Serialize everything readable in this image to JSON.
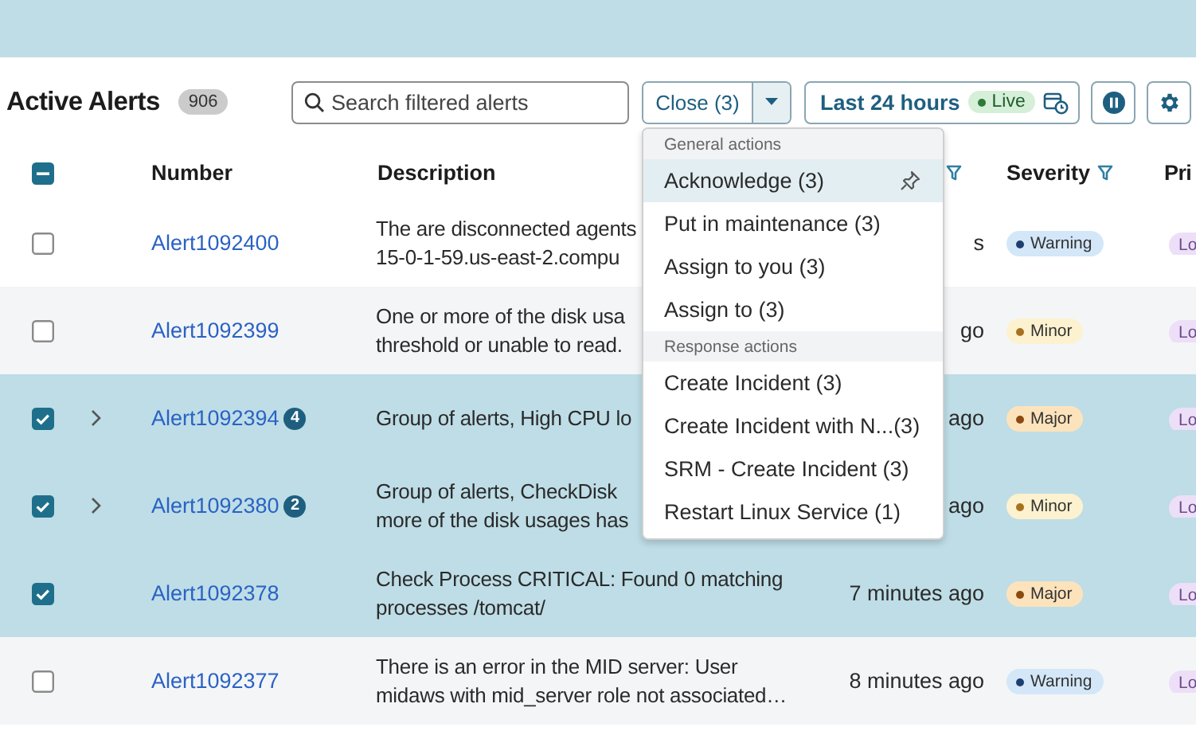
{
  "header": {
    "title": "Active Alerts",
    "count": "906",
    "search": {
      "placeholder": "Search filtered alerts"
    },
    "action_button": {
      "label": "Close (3)",
      "expanded": true
    },
    "time_range": {
      "label": "Last 24 hours",
      "live": "Live"
    }
  },
  "table": {
    "header_checkbox": {
      "indeterminate": true
    },
    "columns": [
      {
        "label": "Number",
        "filter": false
      },
      {
        "label": "Description",
        "filter": false
      },
      {
        "filter": true
      },
      {
        "label": "Severity",
        "filter": true
      },
      {
        "label": "Pri",
        "filter": false
      }
    ],
    "rows": [
      {
        "selected": false,
        "expandable": false,
        "number": "Alert1092400",
        "description": [
          "The are disconnected agents",
          "15-0-1-59.us-east-2.compu"
        ],
        "time": "s",
        "severity": "Warning",
        "color": "#1d3f70",
        "priority": "Lo"
      },
      {
        "selected": false,
        "expandable": false,
        "number": "Alert1092399",
        "description": [
          "One or more of the disk usa",
          "threshold or unable to read."
        ],
        "time": "go",
        "severity": "Minor",
        "color": "#a8701f",
        "priority": "Lo"
      },
      {
        "selected": true,
        "expandable": true,
        "number": "Alert1092394",
        "group_count": "4",
        "description": [
          "Group of alerts, High CPU lo"
        ],
        "time": "ago",
        "severity": "Major",
        "color": "#8b4a12",
        "priority": "Lo"
      },
      {
        "selected": true,
        "expandable": true,
        "number": "Alert1092380",
        "group_count": "2",
        "description": [
          "Group of alerts, CheckDisk",
          "more of the disk usages has"
        ],
        "time": "ago",
        "severity": "Minor",
        "color": "#a8701f",
        "priority": "Lo"
      },
      {
        "selected": true,
        "expandable": false,
        "number": "Alert1092378",
        "description": [
          "Check Process CRITICAL: Found 0 matching",
          "processes /tomcat/"
        ],
        "time": "7 minutes ago",
        "severity": "Major",
        "color": "#8b4a12",
        "priority": "Lo"
      },
      {
        "selected": false,
        "expandable": false,
        "number": "Alert1092377",
        "description": [
          "There is an error in the MID server: User",
          "midaws with mid_server role not associated…"
        ],
        "time": "8 minutes ago",
        "severity": "Warning",
        "color": "#1d3f70",
        "priority": "Lo"
      }
    ]
  },
  "menu": {
    "sections": [
      {
        "title": "General actions",
        "items": [
          {
            "label": "Acknowledge (3)",
            "selected": true,
            "pin": true
          },
          {
            "label": "Put in maintenance (3)",
            "selected": false,
            "pin": false
          },
          {
            "label": "Assign to you (3)",
            "selected": false,
            "pin": false
          },
          {
            "label": "Assign to (3)",
            "selected": false,
            "pin": false
          }
        ]
      },
      {
        "title": "Response actions",
        "items": [
          {
            "label": "Create Incident (3)",
            "selected": false,
            "pin": false
          },
          {
            "label": "Create Incident with N...(3)",
            "selected": false,
            "pin": false
          },
          {
            "label": "SRM - Create Incident (3)",
            "selected": false,
            "pin": false
          },
          {
            "label": "Restart Linux Service (1)",
            "selected": false,
            "pin": false
          }
        ]
      }
    ]
  }
}
